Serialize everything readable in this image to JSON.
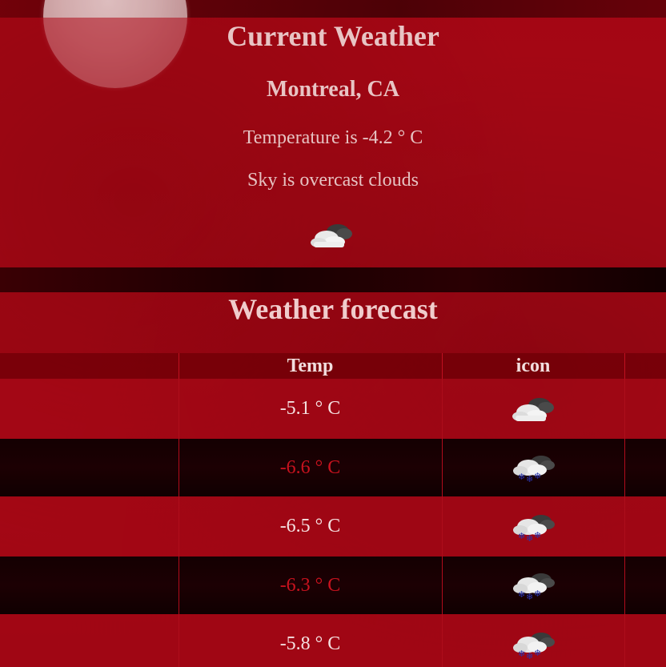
{
  "current": {
    "title": "Current Weather",
    "location": "Montreal, CA",
    "temperature": "Temperature is -4.2 ° C",
    "sky": "Sky is overcast clouds",
    "icon": "overcast-clouds-icon"
  },
  "forecast": {
    "title": "Weather forecast",
    "columns": [
      "Temp",
      "icon"
    ],
    "rows": [
      {
        "temp": "-5.1 ° C",
        "icon": "overcast-clouds-icon"
      },
      {
        "temp": "-6.6 ° C",
        "icon": "snow-clouds-icon"
      },
      {
        "temp": "-6.5 ° C",
        "icon": "snow-clouds-icon"
      },
      {
        "temp": "-6.3 ° C",
        "icon": "snow-clouds-icon"
      },
      {
        "temp": "-5.8 ° C",
        "icon": "snow-clouds-icon"
      }
    ]
  },
  "colors": {
    "background": "#9c0612",
    "dark_row": "#140002",
    "dark_row_text": "#c8121e",
    "light_text": "#f4e0e0"
  }
}
